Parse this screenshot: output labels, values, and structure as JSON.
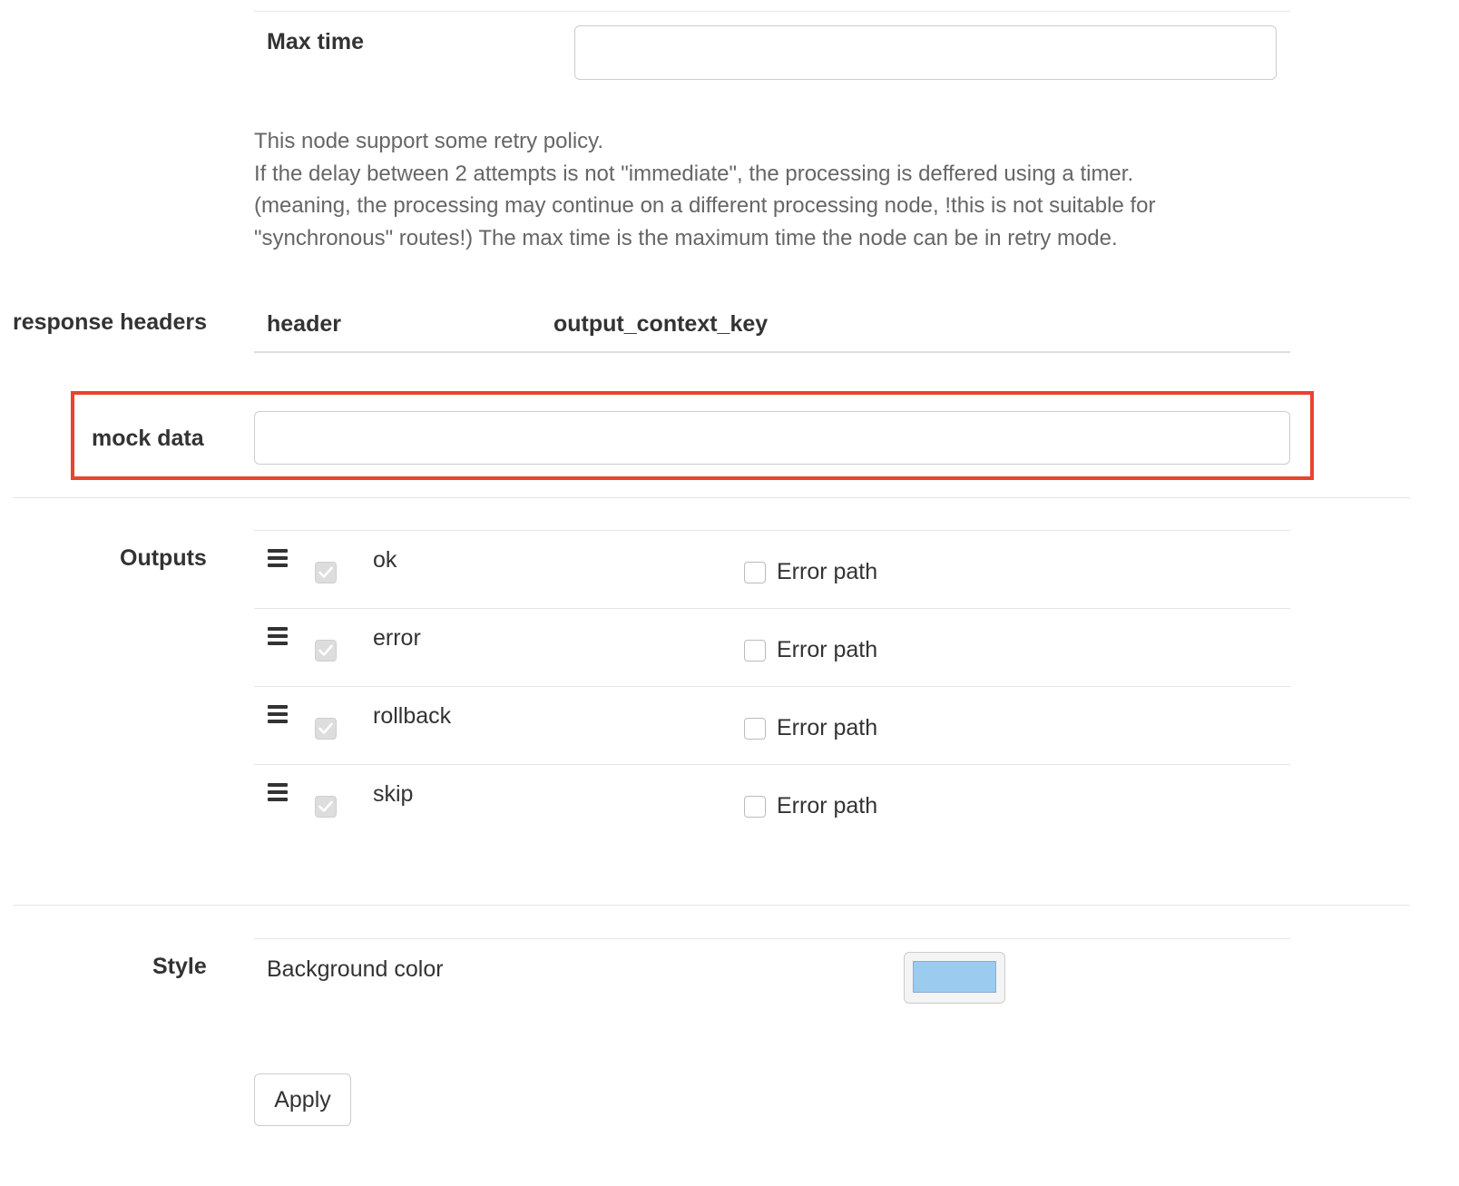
{
  "retry": {
    "max_time_label": "Max time",
    "max_time_value": "",
    "help_lines": [
      "This node support some retry policy.",
      "If the delay between 2 attempts is not \"immediate\", the processing is deffered using a timer.",
      "(meaning, the processing may continue on a different processing node, !this is not suitable for",
      "\"synchronous\" routes!) The max time is the maximum time the node can be in retry mode."
    ]
  },
  "response_headers": {
    "label": "response headers",
    "col_header": "header",
    "col_output": "output_context_key"
  },
  "mock_data": {
    "label": "mock data",
    "value": ""
  },
  "outputs": {
    "label": "Outputs",
    "items": [
      {
        "name": "ok",
        "error_path_label": "Error path"
      },
      {
        "name": "error",
        "error_path_label": "Error path"
      },
      {
        "name": "rollback",
        "error_path_label": "Error path"
      },
      {
        "name": "skip",
        "error_path_label": "Error path"
      }
    ]
  },
  "style": {
    "label": "Style",
    "background_color_label": "Background color",
    "background_color": "#9ccbf0"
  },
  "actions": {
    "apply_label": "Apply"
  },
  "colors": {
    "highlight": "#e8442e",
    "text": "#333333",
    "muted_text": "#666666"
  }
}
